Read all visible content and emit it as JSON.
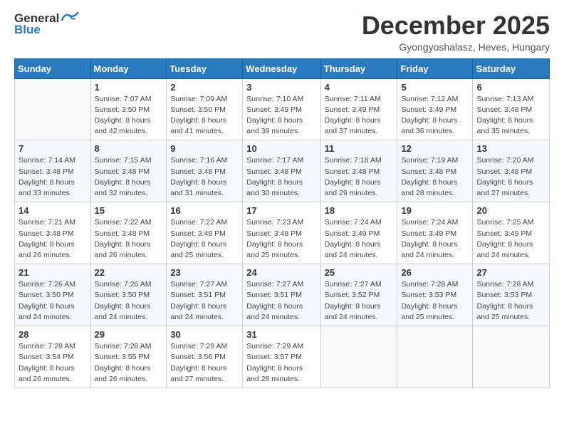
{
  "logo": {
    "general": "General",
    "blue": "Blue"
  },
  "header": {
    "month": "December 2025",
    "location": "Gyongyoshalasz, Heves, Hungary"
  },
  "weekdays": [
    "Sunday",
    "Monday",
    "Tuesday",
    "Wednesday",
    "Thursday",
    "Friday",
    "Saturday"
  ],
  "weeks": [
    [
      {
        "day": "",
        "sunrise": "",
        "sunset": "",
        "daylight": ""
      },
      {
        "day": "1",
        "sunrise": "Sunrise: 7:07 AM",
        "sunset": "Sunset: 3:50 PM",
        "daylight": "Daylight: 8 hours and 42 minutes."
      },
      {
        "day": "2",
        "sunrise": "Sunrise: 7:09 AM",
        "sunset": "Sunset: 3:50 PM",
        "daylight": "Daylight: 8 hours and 41 minutes."
      },
      {
        "day": "3",
        "sunrise": "Sunrise: 7:10 AM",
        "sunset": "Sunset: 3:49 PM",
        "daylight": "Daylight: 8 hours and 39 minutes."
      },
      {
        "day": "4",
        "sunrise": "Sunrise: 7:11 AM",
        "sunset": "Sunset: 3:49 PM",
        "daylight": "Daylight: 8 hours and 37 minutes."
      },
      {
        "day": "5",
        "sunrise": "Sunrise: 7:12 AM",
        "sunset": "Sunset: 3:49 PM",
        "daylight": "Daylight: 8 hours and 36 minutes."
      },
      {
        "day": "6",
        "sunrise": "Sunrise: 7:13 AM",
        "sunset": "Sunset: 3:48 PM",
        "daylight": "Daylight: 8 hours and 35 minutes."
      }
    ],
    [
      {
        "day": "7",
        "sunrise": "Sunrise: 7:14 AM",
        "sunset": "Sunset: 3:48 PM",
        "daylight": "Daylight: 8 hours and 33 minutes."
      },
      {
        "day": "8",
        "sunrise": "Sunrise: 7:15 AM",
        "sunset": "Sunset: 3:48 PM",
        "daylight": "Daylight: 8 hours and 32 minutes."
      },
      {
        "day": "9",
        "sunrise": "Sunrise: 7:16 AM",
        "sunset": "Sunset: 3:48 PM",
        "daylight": "Daylight: 8 hours and 31 minutes."
      },
      {
        "day": "10",
        "sunrise": "Sunrise: 7:17 AM",
        "sunset": "Sunset: 3:48 PM",
        "daylight": "Daylight: 8 hours and 30 minutes."
      },
      {
        "day": "11",
        "sunrise": "Sunrise: 7:18 AM",
        "sunset": "Sunset: 3:48 PM",
        "daylight": "Daylight: 8 hours and 29 minutes."
      },
      {
        "day": "12",
        "sunrise": "Sunrise: 7:19 AM",
        "sunset": "Sunset: 3:48 PM",
        "daylight": "Daylight: 8 hours and 28 minutes."
      },
      {
        "day": "13",
        "sunrise": "Sunrise: 7:20 AM",
        "sunset": "Sunset: 3:48 PM",
        "daylight": "Daylight: 8 hours and 27 minutes."
      }
    ],
    [
      {
        "day": "14",
        "sunrise": "Sunrise: 7:21 AM",
        "sunset": "Sunset: 3:48 PM",
        "daylight": "Daylight: 8 hours and 26 minutes."
      },
      {
        "day": "15",
        "sunrise": "Sunrise: 7:22 AM",
        "sunset": "Sunset: 3:48 PM",
        "daylight": "Daylight: 8 hours and 26 minutes."
      },
      {
        "day": "16",
        "sunrise": "Sunrise: 7:22 AM",
        "sunset": "Sunset: 3:48 PM",
        "daylight": "Daylight: 8 hours and 25 minutes."
      },
      {
        "day": "17",
        "sunrise": "Sunrise: 7:23 AM",
        "sunset": "Sunset: 3:48 PM",
        "daylight": "Daylight: 8 hours and 25 minutes."
      },
      {
        "day": "18",
        "sunrise": "Sunrise: 7:24 AM",
        "sunset": "Sunset: 3:49 PM",
        "daylight": "Daylight: 8 hours and 24 minutes."
      },
      {
        "day": "19",
        "sunrise": "Sunrise: 7:24 AM",
        "sunset": "Sunset: 3:49 PM",
        "daylight": "Daylight: 8 hours and 24 minutes."
      },
      {
        "day": "20",
        "sunrise": "Sunrise: 7:25 AM",
        "sunset": "Sunset: 3:49 PM",
        "daylight": "Daylight: 8 hours and 24 minutes."
      }
    ],
    [
      {
        "day": "21",
        "sunrise": "Sunrise: 7:26 AM",
        "sunset": "Sunset: 3:50 PM",
        "daylight": "Daylight: 8 hours and 24 minutes."
      },
      {
        "day": "22",
        "sunrise": "Sunrise: 7:26 AM",
        "sunset": "Sunset: 3:50 PM",
        "daylight": "Daylight: 8 hours and 24 minutes."
      },
      {
        "day": "23",
        "sunrise": "Sunrise: 7:27 AM",
        "sunset": "Sunset: 3:51 PM",
        "daylight": "Daylight: 8 hours and 24 minutes."
      },
      {
        "day": "24",
        "sunrise": "Sunrise: 7:27 AM",
        "sunset": "Sunset: 3:51 PM",
        "daylight": "Daylight: 8 hours and 24 minutes."
      },
      {
        "day": "25",
        "sunrise": "Sunrise: 7:27 AM",
        "sunset": "Sunset: 3:52 PM",
        "daylight": "Daylight: 8 hours and 24 minutes."
      },
      {
        "day": "26",
        "sunrise": "Sunrise: 7:28 AM",
        "sunset": "Sunset: 3:53 PM",
        "daylight": "Daylight: 8 hours and 25 minutes."
      },
      {
        "day": "27",
        "sunrise": "Sunrise: 7:28 AM",
        "sunset": "Sunset: 3:53 PM",
        "daylight": "Daylight: 8 hours and 25 minutes."
      }
    ],
    [
      {
        "day": "28",
        "sunrise": "Sunrise: 7:28 AM",
        "sunset": "Sunset: 3:54 PM",
        "daylight": "Daylight: 8 hours and 26 minutes."
      },
      {
        "day": "29",
        "sunrise": "Sunrise: 7:28 AM",
        "sunset": "Sunset: 3:55 PM",
        "daylight": "Daylight: 8 hours and 26 minutes."
      },
      {
        "day": "30",
        "sunrise": "Sunrise: 7:28 AM",
        "sunset": "Sunset: 3:56 PM",
        "daylight": "Daylight: 8 hours and 27 minutes."
      },
      {
        "day": "31",
        "sunrise": "Sunrise: 7:29 AM",
        "sunset": "Sunset: 3:57 PM",
        "daylight": "Daylight: 8 hours and 28 minutes."
      },
      {
        "day": "",
        "sunrise": "",
        "sunset": "",
        "daylight": ""
      },
      {
        "day": "",
        "sunrise": "",
        "sunset": "",
        "daylight": ""
      },
      {
        "day": "",
        "sunrise": "",
        "sunset": "",
        "daylight": ""
      }
    ]
  ]
}
